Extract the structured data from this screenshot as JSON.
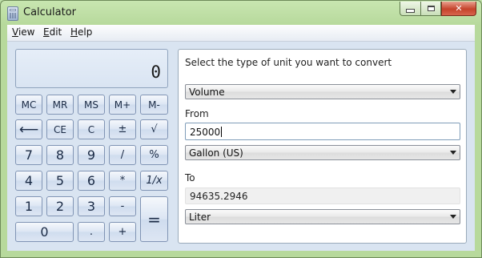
{
  "window": {
    "title": "Calculator"
  },
  "menubar": [
    {
      "pre": "",
      "u": "V",
      "post": "iew"
    },
    {
      "pre": "",
      "u": "E",
      "post": "dit"
    },
    {
      "pre": "",
      "u": "H",
      "post": "elp"
    }
  ],
  "display": {
    "value": "0"
  },
  "keys": {
    "mc": "MC",
    "mr": "MR",
    "ms": "MS",
    "mplus": "M+",
    "mminus": "M-",
    "back": "⟵",
    "ce": "CE",
    "c": "C",
    "plusminus": "±",
    "sqrt": "√",
    "k7": "7",
    "k8": "8",
    "k9": "9",
    "divide": "/",
    "percent": "%",
    "k4": "4",
    "k5": "5",
    "k6": "6",
    "multiply": "*",
    "reciprocal": "1/x",
    "k1": "1",
    "k2": "2",
    "k3": "3",
    "minus": "-",
    "equals": "=",
    "k0": "0",
    "decimal": ".",
    "plus": "+"
  },
  "converter": {
    "prompt": "Select the type of unit you want to convert",
    "type": "Volume",
    "from_label": "From",
    "from_value": "25000",
    "from_unit": "Gallon (US)",
    "to_label": "To",
    "to_value": "94635.2946",
    "to_unit": "Liter"
  }
}
